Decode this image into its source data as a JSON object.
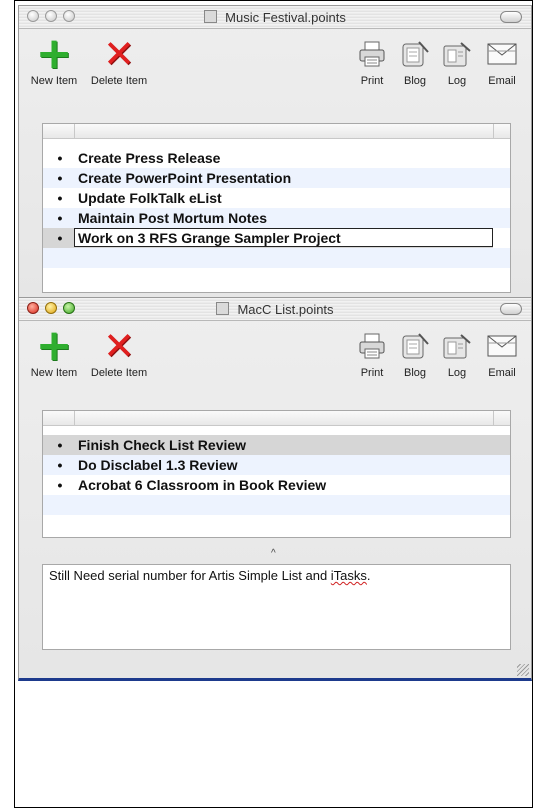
{
  "window1": {
    "title": "Music Festival.points",
    "toolbar": {
      "new_item": "New Item",
      "delete_item": "Delete Item",
      "print": "Print",
      "blog": "Blog",
      "log": "Log",
      "email": "Email"
    },
    "items": [
      "Create Press Release",
      "Create PowerPoint Presentation",
      "Update FolkTalk eList",
      "Maintain Post Mortum Notes",
      "Work on 3 RFS Grange Sampler Project"
    ]
  },
  "window2": {
    "title": "MacC List.points",
    "toolbar": {
      "new_item": "New Item",
      "delete_item": "Delete Item",
      "print": "Print",
      "blog": "Blog",
      "log": "Log",
      "email": "Email"
    },
    "items": [
      "Finish Check List Review",
      "Do Disclabel 1.3 Review",
      "Acrobat 6 Classroom in Book Review"
    ],
    "notes_prefix": "Still Need serial number for Artis Simple List and ",
    "notes_misspelled": "iTasks",
    "notes_suffix": "."
  },
  "bullet": "•",
  "colors": {
    "new_item_icon": "#2fae2f",
    "delete_item_icon": "#e02020",
    "selection_row": "#d6d6d6",
    "alternate_row": "#edf3fe",
    "window_bottom_edge": "#1d3a8c"
  },
  "icons": {
    "new_item": "plus-icon",
    "delete_item": "x-icon",
    "print": "printer-icon",
    "blog": "blog-icon",
    "log": "log-icon",
    "email": "envelope-icon"
  }
}
